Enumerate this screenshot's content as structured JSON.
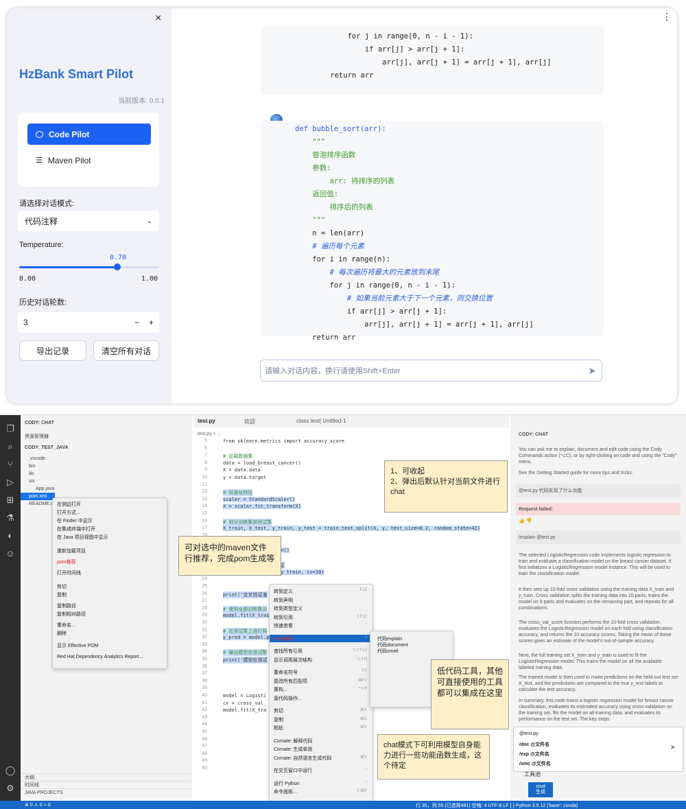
{
  "top": {
    "close_glyph": "×",
    "more_glyph": "⋮",
    "sidebar": {
      "title": "HzBank Smart Pilot",
      "version": "当前版本: 0.0.1",
      "nav": [
        {
          "label": "Code Pilot",
          "icon": "chat-bubble-icon",
          "active": true
        },
        {
          "label": "Maven Pilot",
          "icon": "list-icon",
          "active": false
        }
      ],
      "mode_label": "请选择对话模式:",
      "mode_value": "代码注释",
      "temperature_label": "Temperature:",
      "temperature_value": "0.70",
      "temperature_level": 0.7,
      "temperature_min": "0.00",
      "temperature_max": "1.00",
      "history_label": "历史对话轮数:",
      "history_value": "3",
      "minus": "−",
      "plus": "+",
      "export_button": "导出记录",
      "clear_button": "清空所有对话"
    },
    "chat": {
      "input_placeholder": "请输入对话内容，换行请使用Shift+Enter",
      "block1": [
        "        for j in range(0, n - i - 1):",
        "            if arr[j] > arr[j + 1]:",
        "                arr[j], arr[j + 1] = arr[j + 1], arr[j]",
        "    return arr"
      ],
      "block2": [
        "def bubble_sort(arr):",
        "    \"\"\"",
        "    冒泡排序函数",
        "    参数:",
        "        arr: 待排序的列表",
        "    返回值:",
        "        排序后的列表",
        "    \"\"\"",
        "    n = len(arr)",
        "    # 遍历每个元素",
        "    for i in range(n):",
        "        # 每次遍历将最大的元素放到末尾",
        "        for j in range(0, n - i - 1):",
        "            # 如果当前元素大于下一个元素，则交换位置",
        "            if arr[j] > arr[j + 1]:",
        "                arr[j], arr[j + 1] = arr[j + 1], arr[j]",
        "    return arr"
      ]
    }
  },
  "ide": {
    "explorer": {
      "header": "CODY: CHAT",
      "subheader": "资源管理器",
      "project": "CODY_TEST_JAVA",
      "tree": [
        ".vscode",
        "bin",
        "lib",
        "src",
        "App.java",
        "pom.xml",
        "README.md"
      ],
      "bottom": [
        "大纲",
        "时间线",
        "JAVA PROJECTS"
      ]
    },
    "context_menu_left": [
      "在侧边打开",
      "打开方式...",
      "在 Finder 中显示",
      "在集成终端中打开",
      "在 Java 项目视图中显示",
      "重新加载项目",
      "pom推荐",
      "打开时间线",
      "剪切",
      "复制",
      "复制路径",
      "复制相对路径",
      "重命名...",
      "删除",
      "显示 Effective POM",
      "Red Hat Dependency Analytics Report..."
    ],
    "tabs": [
      "test.py",
      "欢迎",
      "class test(  Untitled-1"
    ],
    "breadcrumb": "test.py > ...",
    "code": [
      {
        "n": "5",
        "t": "from sklearn.metrics import accuracy_score",
        "hl": false
      },
      {
        "n": "6",
        "t": "",
        "hl": false
      },
      {
        "n": "7",
        "t": "# 加载数据集",
        "hl": false
      },
      {
        "n": "8",
        "t": "data = load_breast_cancer()",
        "hl": false
      },
      {
        "n": "9",
        "t": "X = data.data",
        "hl": false
      },
      {
        "n": "10",
        "t": "y = data.target",
        "hl": false
      },
      {
        "n": "11",
        "t": "",
        "hl": false
      },
      {
        "n": "12",
        "t": "# 标准化特征",
        "hl": true
      },
      {
        "n": "13",
        "t": "scaler = StandardScaler()",
        "hl": true
      },
      {
        "n": "14",
        "t": "X = scaler.fit_transform(X)",
        "hl": true
      },
      {
        "n": "15",
        "t": "",
        "hl": true
      },
      {
        "n": "16",
        "t": "# 划分训练集和测试集",
        "hl": true
      },
      {
        "n": "17",
        "t": "X_train, X_test, y_train, y_test = train_test_split(X, y, test_size=0.2, random_state=42)",
        "hl": true
      },
      {
        "n": "18",
        "t": "",
        "hl": true
      },
      {
        "n": "19",
        "t": "",
        "hl": true
      },
      {
        "n": "20",
        "t": "                  ion()",
        "hl": true
      },
      {
        "n": "21",
        "t": "",
        "hl": true
      },
      {
        "n": "22",
        "t": "      们使用10折交叉验证",
        "hl": true
      },
      {
        "n": "23",
        "t": "      del, X_train, y_train, cv=10)",
        "hl": true
      },
      {
        "n": "24",
        "t": "",
        "hl": true
      },
      {
        "n": "25",
        "t": "",
        "hl": true
      },
      {
        "n": "26",
        "t": "print('交叉验证准",
        "hl": true
      },
      {
        "n": "27",
        "t": "",
        "hl": true
      },
      {
        "n": "28",
        "t": "# 使用全部训练集训",
        "hl": true
      },
      {
        "n": "29",
        "t": "model.fit(X_trai",
        "hl": true
      },
      {
        "n": "30",
        "t": "",
        "hl": true
      },
      {
        "n": "31",
        "t": "# 在测试集上进行预",
        "hl": true
      },
      {
        "n": "32",
        "t": "y_pred = model.p",
        "hl": true
      },
      {
        "n": "33",
        "t": "",
        "hl": true
      },
      {
        "n": "34",
        "t": "# 输出模型在测试集",
        "hl": true
      },
      {
        "n": "35",
        "t": "print('模型在测试",
        "hl": true
      },
      {
        "n": "36",
        "t": "",
        "hl": false
      },
      {
        "n": "37",
        "t": "",
        "hl": false
      },
      {
        "n": "38",
        "t": "",
        "hl": false
      },
      {
        "n": "39",
        "t": "",
        "hl": false
      },
      {
        "n": "40",
        "t": "model = Logisti",
        "hl": false
      },
      {
        "n": "41",
        "t": "cv = cross_val_",
        "hl": false
      },
      {
        "n": "42",
        "t": "model.fit(X_tra",
        "hl": false
      },
      {
        "n": "43",
        "t": "",
        "hl": false
      },
      {
        "n": "44",
        "t": "",
        "hl": false
      },
      {
        "n": "45",
        "t": "",
        "hl": false
      },
      {
        "n": "46",
        "t": "",
        "hl": false
      },
      {
        "n": "47",
        "t": "",
        "hl": false
      },
      {
        "n": "48",
        "t": "",
        "hl": false
      },
      {
        "n": "49",
        "t": "",
        "hl": false
      },
      {
        "n": "50",
        "t": "",
        "hl": false
      }
    ],
    "context_menu_editor": [
      {
        "t": "转到定义",
        "k": "F12"
      },
      {
        "t": "转到声明",
        "k": ""
      },
      {
        "t": "转到类型定义",
        "k": ""
      },
      {
        "t": "转到引用",
        "k": "⇧F12"
      },
      {
        "t": "快速查看",
        "k": "›"
      },
      {
        "t": "Cody助手",
        "k": "›"
      },
      {
        "t": "查找所有引用",
        "k": "⌥⇧F12"
      },
      {
        "t": "显示调用层次结构",
        "k": "⌥⇧H"
      },
      {
        "t": "重命名符号",
        "k": "F2"
      },
      {
        "t": "更改所有匹配项",
        "k": "⌘F2"
      },
      {
        "t": "重构...",
        "k": "^⇧R"
      },
      {
        "t": "源代码操作...",
        "k": ""
      },
      {
        "t": "剪切",
        "k": "⌘X"
      },
      {
        "t": "复制",
        "k": "⌘C"
      },
      {
        "t": "粘贴",
        "k": "⌘V"
      },
      {
        "t": "Comate: 解释代码",
        "k": ""
      },
      {
        "t": "Comate: 生成单测",
        "k": ""
      },
      {
        "t": "Comate: 自然语言生成代码",
        "k": "⌘Y"
      },
      {
        "t": "在交互窗口中运行",
        "k": "›"
      },
      {
        "t": "运行 Python",
        "k": "›"
      },
      {
        "t": "命令面板...",
        "k": "⇧⌘P"
      }
    ],
    "submenu": [
      "代码explain",
      "代码document",
      "代码smell"
    ],
    "callouts": {
      "c1": "1、可收起\n2、弹出后默认针对当前文件进行chat",
      "c2": "可对选中的maven文件行推荐，完成pom生成等",
      "c3": "低代码工具，其他可直接使用的工具都可以集成在这里",
      "c4": "chat模式下可利用模型自身能力进行一些功能函数生成，这个待定"
    },
    "right": {
      "header": "CODY: CHAT",
      "intro1": "You can ask me to explain, document and edit code using the Cody Commands action (⌥C), or by right-clicking on code and using the \"Cody\" menu.",
      "intro2": "See the Getting Started guide for more tips and tricks.",
      "q1": "@test.py 代码实现了什么功能",
      "failed": "Request failed:",
      "q2": "/explain @test.py",
      "a1": "The selected LogisticRegression code implements logistic regression to train and evaluate a classification model on the breast cancer dataset.\nIt first initializes a LogisticRegression model instance. This will be used to train the classification model.",
      "a2": "It then sets up 10-fold cross validation using the training data X_train and y_train. Cross validation splits the training data into 10 parts, trains the model on 9 parts and evaluates on the remaining part, and repeats for all combinations.",
      "a3": "The cross_val_score function performs the 10-fold cross validation, evaluates the LogisticRegression model on each fold using classification accuracy, and returns the 10 accuracy scores. Taking the mean of these scores gives an estimate of the model's out-of-sample accuracy.",
      "a4": "Next, the full training set X_train and y_train is used to fit the LogisticRegression model. This trains the model on all the available labeled training data.",
      "a5": "The trained model is then used to make predictions on the held-out test set X_test, and the predictions are compared to the true y_test labels to calculate the test accuracy.",
      "a6": "In summary, this code trains a logistic regression model for breast cancer classification, evaluates its estimated accuracy using cross-validation on the training set, fits the model on all training data, and evaluates its performance on the test set. The key steps",
      "input_lines": [
        "@test.py",
        "/doc @文件名",
        "/exp @文件名",
        "/smc @文件名"
      ],
      "tool_pool": "工具池",
      "crud": "crud\n生成"
    },
    "status": {
      "left": "⊗ 0 ⚠ 0   ⑃ 0",
      "right": "行 35，列 55 (已选择481)   空格: 4   UTF-8   LF   { } Python   3.9.12 ('base': conda)"
    }
  }
}
